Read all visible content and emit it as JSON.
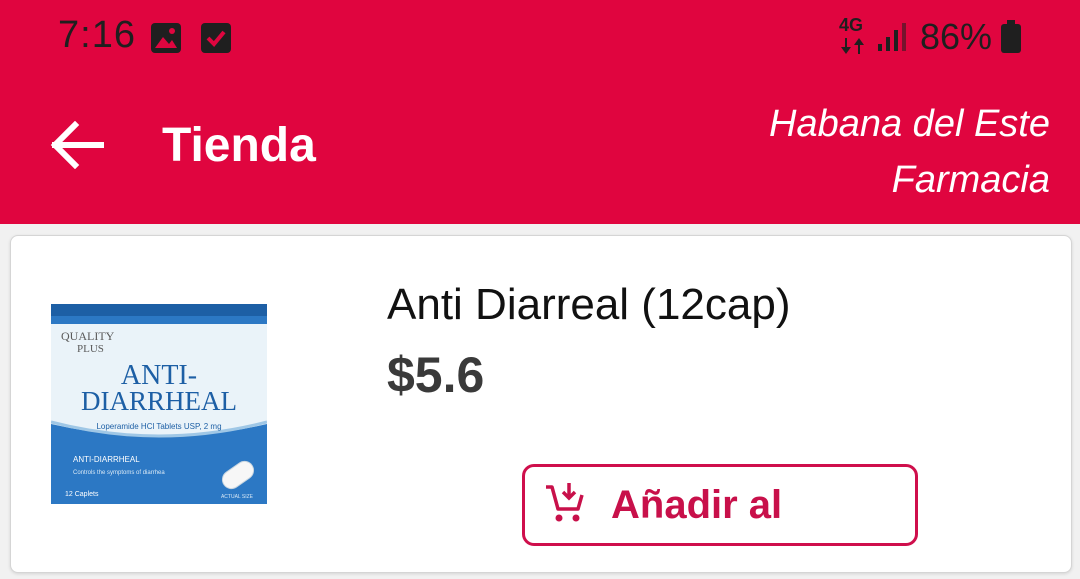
{
  "status_bar": {
    "time": "7:16",
    "network": "4G",
    "battery": "86%"
  },
  "header": {
    "title": "Tienda",
    "store_line1": "Habana del Este",
    "store_line2": "Farmacia"
  },
  "product": {
    "name": "Anti Diarreal (12cap)",
    "price": "$5.6",
    "add_label": "Añadir al",
    "package": {
      "brand_line1": "QUALITY",
      "brand_line2": "PLUS",
      "title_line1": "ANTI-",
      "title_line2": "DIARRHEAL",
      "subtitle": "Loperamide HCl Tablets USP, 2 mg",
      "band_title": "ANTI-DIARRHEAL",
      "band_text": "Controls the symptoms of diarrhea",
      "count": "12 Caplets",
      "size_note": "ACTUAL SIZE"
    }
  },
  "colors": {
    "brand": "#e0053f",
    "accent": "#c8104a"
  },
  "icons": {
    "back": "arrow-left-icon",
    "add_to_cart": "add-shopping-cart-icon"
  }
}
